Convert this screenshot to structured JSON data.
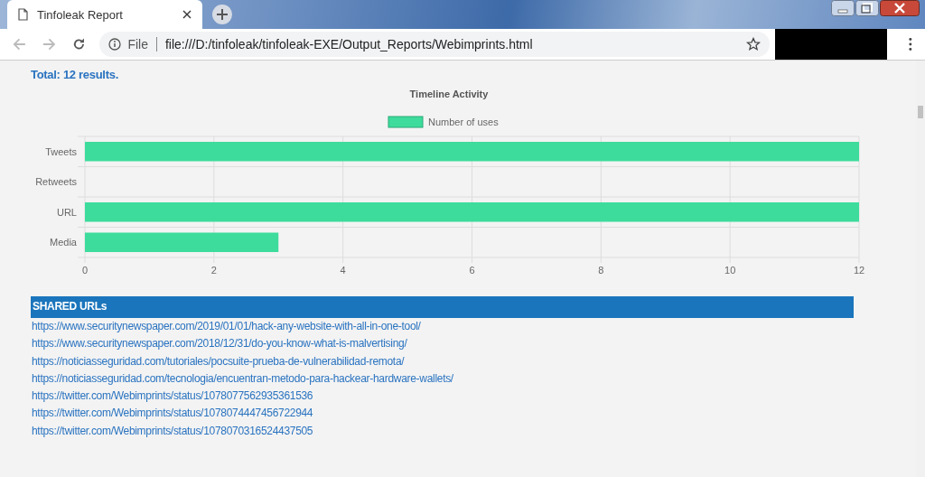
{
  "browser": {
    "tab": {
      "title": "Tinfoleak Report",
      "selected": true
    },
    "address": {
      "scheme": "File",
      "url": "file:///D:/tinfoleak/tinfoleak-EXE/Output_Reports/Webimprints.html"
    }
  },
  "page": {
    "total": "Total: 12 results.",
    "chart": {
      "chart_data": {
        "type": "bar",
        "orientation": "horizontal",
        "title": "Timeline Activity",
        "categories": [
          "Tweets",
          "Retweets",
          "URL",
          "Media"
        ],
        "series": [
          {
            "name": "Number of uses",
            "color": "#3ddc9c",
            "values": [
              12,
              0,
              12,
              3
            ]
          }
        ],
        "xlim": [
          0,
          12
        ],
        "grid": true,
        "xticks": [
          0,
          2,
          4,
          6,
          8,
          10,
          12
        ]
      }
    },
    "shared_urls": {
      "heading": "SHARED URLs",
      "urls": [
        "https://www.securitynewspaper.com/2019/01/01/hack-any-website-with-all-in-one-tool/",
        "https://www.securitynewspaper.com/2018/12/31/do-you-know-what-is-malvertising/",
        "https://noticiasseguridad.com/tutoriales/pocsuite-prueba-de-vulnerabilidad-remota/",
        "https://noticiasseguridad.com/tecnologia/encuentran-metodo-para-hackear-hardware-wallets/",
        "https://twitter.com/Webimprints/status/1078077562935361536",
        "https://twitter.com/Webimprints/status/1078074447456722944",
        "https://twitter.com/Webimprints/status/1078070316524437505"
      ]
    }
  }
}
